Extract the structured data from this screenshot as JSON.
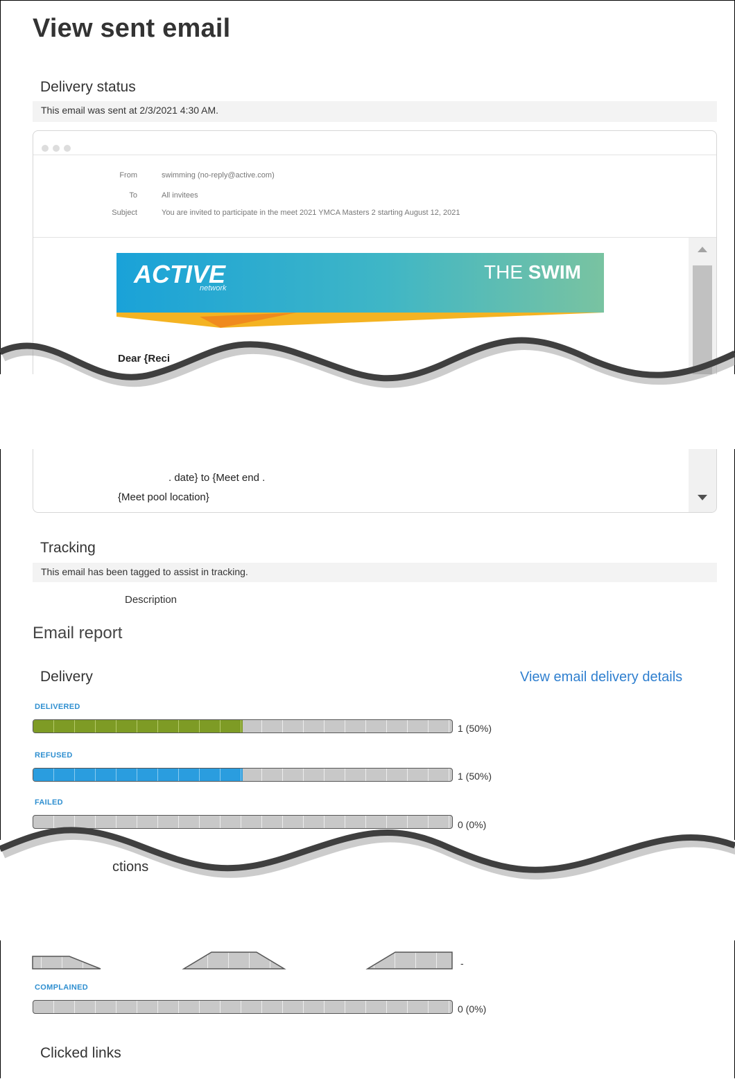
{
  "page_title": "View sent email",
  "delivery_status": {
    "heading": "Delivery status",
    "message": "This email was sent at 2/3/2021 4:30 AM."
  },
  "email_preview": {
    "from_label": "From",
    "from_value": "swimming (no-reply@active.com)",
    "to_label": "To",
    "to_value": "All invitees",
    "subject_label": "Subject",
    "subject_value": "You are invited to participate in the meet 2021 YMCA Masters 2 starting August 12, 2021",
    "banner_logo_text": "ACTIVE",
    "banner_logo_sub": "network",
    "banner_right_a": "THE ",
    "banner_right_b": "SWIM",
    "greeting": "Dear {Reci",
    "line_dates": ". date} to {Meet end .",
    "line_location": "{Meet pool location}"
  },
  "tracking": {
    "heading": "Tracking",
    "message": "This email has been tagged to assist in tracking.",
    "description_label": "Description"
  },
  "email_report": {
    "heading": "Email report",
    "delivery_heading": "Delivery",
    "details_link": "View email delivery details",
    "bars": [
      {
        "label": "DELIVERED",
        "count_text": "1 (50%)",
        "fraction": 0.5,
        "color": "#7e9b25"
      },
      {
        "label": "REFUSED",
        "count_text": "1 (50%)",
        "fraction": 0.5,
        "color": "#2a9ddf"
      },
      {
        "label": "FAILED",
        "count_text": "0 (0%)",
        "fraction": 0,
        "color": "#c8c8c8"
      }
    ],
    "interactions_partial": "ctions",
    "partial_count_text": "-",
    "complained": {
      "label": "COMPLAINED",
      "count_text": "0 (0%)",
      "fraction": 0
    },
    "clicked_links_heading": "Clicked links"
  }
}
